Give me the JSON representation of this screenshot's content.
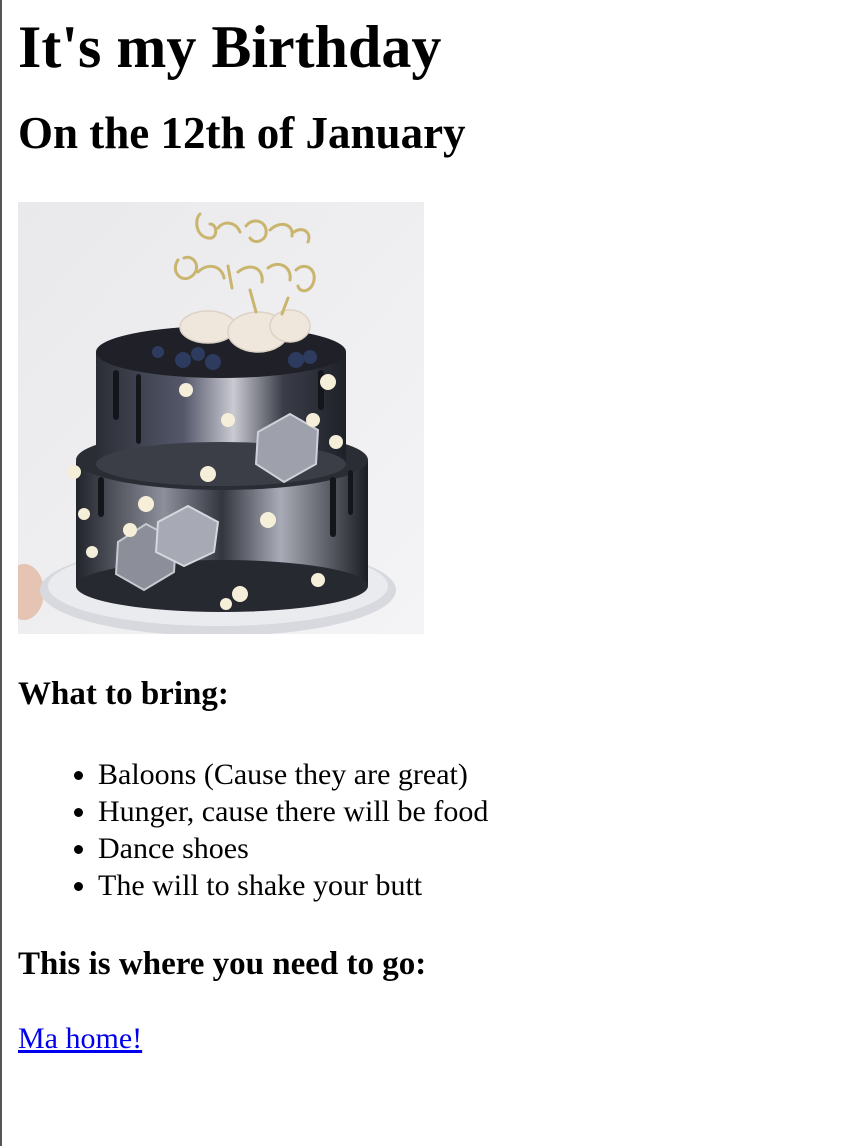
{
  "page": {
    "title": "It's my Birthday",
    "subtitle": "On the 12th of January"
  },
  "image": {
    "alt": "Two-tier black and marbled birthday cake with a gold Happy Birthday topper",
    "topper_text_line1": "Happy",
    "topper_text_line2": "Birthday"
  },
  "bring": {
    "heading": "What to bring:",
    "items": [
      "Baloons (Cause they are great)",
      "Hunger, cause there will be food",
      "Dance shoes",
      "The will to shake your butt"
    ]
  },
  "directions": {
    "heading": "This is where you need to go:",
    "link_text": "Ma home!"
  },
  "colors": {
    "link": "#0000ee",
    "text": "#000000",
    "background": "#ffffff"
  }
}
